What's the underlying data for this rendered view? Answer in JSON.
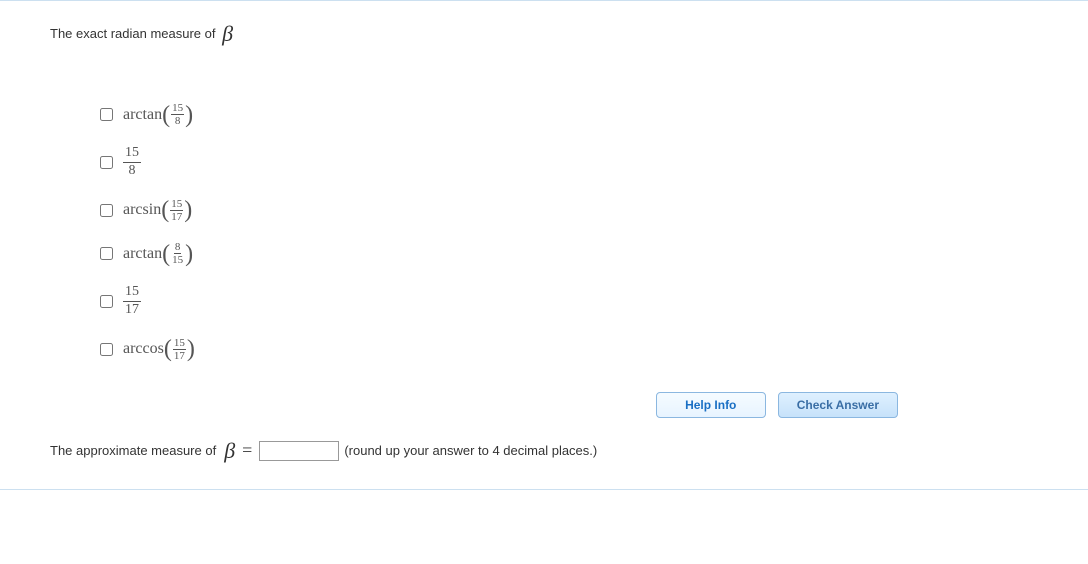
{
  "question": {
    "prompt_prefix": "The exact radian measure of ",
    "variable_symbol": "β"
  },
  "options": [
    {
      "type": "func_frac",
      "func": "arctan",
      "num": "15",
      "den": "8"
    },
    {
      "type": "frac",
      "num": "15",
      "den": "8"
    },
    {
      "type": "func_frac",
      "func": "arcsin",
      "num": "15",
      "den": "17"
    },
    {
      "type": "func_frac",
      "func": "arctan",
      "num": "8",
      "den": "15"
    },
    {
      "type": "frac",
      "num": "15",
      "den": "17"
    },
    {
      "type": "func_frac",
      "func": "arccos",
      "num": "15",
      "den": "17"
    }
  ],
  "buttons": {
    "help": "Help Info",
    "check": "Check Answer"
  },
  "approx": {
    "prefix": "The approximate measure of ",
    "variable_symbol": "β",
    "equals": "=",
    "value": "",
    "hint": "(round up your answer to 4 decimal places.)"
  }
}
